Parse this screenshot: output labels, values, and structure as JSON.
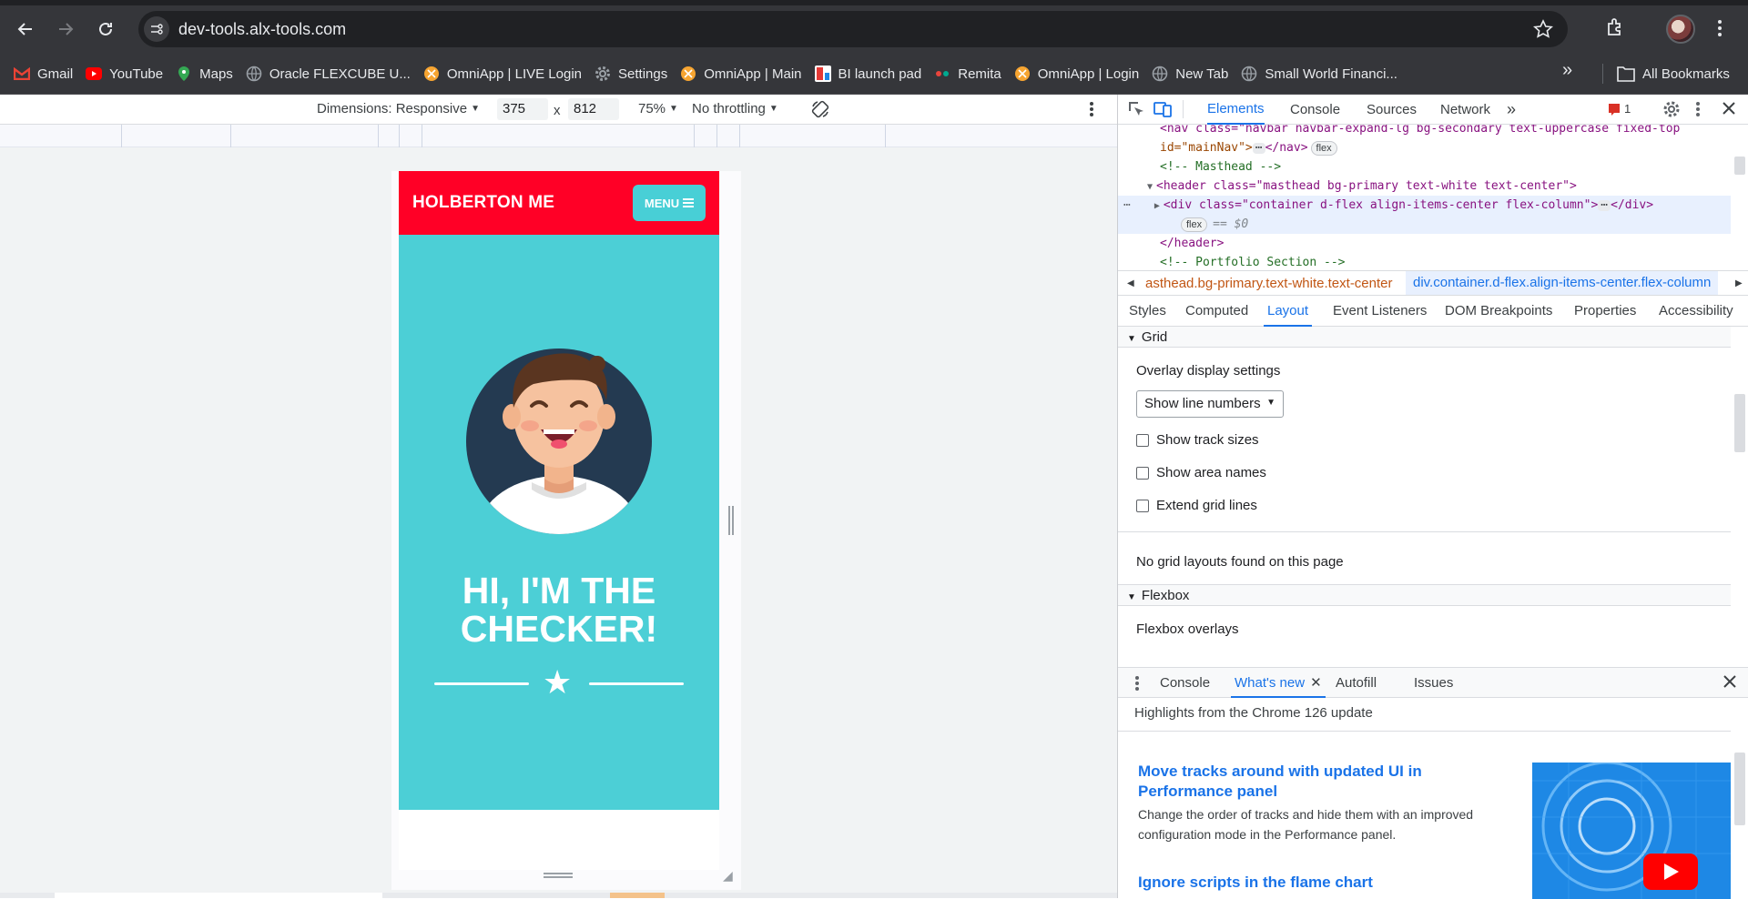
{
  "browser": {
    "url": "dev-tools.alx-tools.com",
    "bookmarks": [
      {
        "label": "Gmail",
        "icon": "gmail-icon",
        "color": "#ea4335"
      },
      {
        "label": "YouTube",
        "icon": "youtube-icon",
        "color": "#ff0000"
      },
      {
        "label": "Maps",
        "icon": "maps-icon",
        "color": "#34a853"
      },
      {
        "label": "Oracle FLEXCUBE U...",
        "icon": "globe-icon",
        "color": "#9aa0a6"
      },
      {
        "label": "OmniApp | LIVE Login",
        "icon": "omniapp-icon",
        "color": "#f7a531"
      },
      {
        "label": "Settings",
        "icon": "gear-icon",
        "color": "#9aa0a6"
      },
      {
        "label": "OmniApp | Main",
        "icon": "omniapp-icon",
        "color": "#f7a531"
      },
      {
        "label": "BI launch pad",
        "icon": "bi-icon",
        "color": "#e53935"
      },
      {
        "label": "Remita",
        "icon": "remita-icon",
        "color": "#e8453c"
      },
      {
        "label": "OmniApp | Login",
        "icon": "omniapp-icon",
        "color": "#f7a531"
      },
      {
        "label": "New Tab",
        "icon": "globe-icon",
        "color": "#9aa0a6"
      },
      {
        "label": "Small World Financi...",
        "icon": "globe-icon",
        "color": "#9aa0a6"
      }
    ],
    "all_bookmarks": "All Bookmarks"
  },
  "device_toolbar": {
    "dimensions": "Dimensions: Responsive",
    "width": "375",
    "times": "x",
    "height": "812",
    "zoom": "75%",
    "throttling": "No throttling"
  },
  "site": {
    "brand": "HOLBERTON ME",
    "menu": "MENU",
    "hero_line1": "HI, I'M THE",
    "hero_line2": "CHECKER!",
    "nav_color": "#ff0026",
    "masthead_color": "#4ccfd6"
  },
  "devtools": {
    "tabs": [
      "Elements",
      "Console",
      "Sources",
      "Network"
    ],
    "issues_count": "1",
    "dom": {
      "nav_line": "<nav class=\"navbar navbar-expand-lg bg-secondary text-uppercase fixed-top",
      "nav_id": "id=\"mainNav\">",
      "nav_close": "</nav>",
      "flex_badge": "flex",
      "comment_masthead": "<!-- Masthead -->",
      "header_open": "<header class=\"masthead bg-primary text-white text-center\">",
      "div_open": "<div class=\"container d-flex align-items-center flex-column\">",
      "div_close": "</div>",
      "eq_zero": "== $0",
      "header_close": "</header>",
      "comment_portfolio": "<!-- Portfolio Section -->"
    },
    "breadcrumb": {
      "crumb1": "asthead.bg-primary.text-white.text-center",
      "crumb2": "div.container.d-flex.align-items-center.flex-column"
    },
    "sub_tabs": [
      "Styles",
      "Computed",
      "Layout",
      "Event Listeners",
      "DOM Breakpoints",
      "Properties",
      "Accessibility"
    ],
    "layout": {
      "grid_section": "Grid",
      "overlay_settings": "Overlay display settings",
      "show_line_numbers": "Show line numbers",
      "show_track_sizes": "Show track sizes",
      "show_area_names": "Show area names",
      "extend_grid_lines": "Extend grid lines",
      "no_grid": "No grid layouts found on this page",
      "flexbox_section": "Flexbox",
      "flexbox_overlays": "Flexbox overlays"
    },
    "drawer": {
      "tabs": [
        "Console",
        "What's new",
        "Autofill",
        "Issues"
      ],
      "highlights": "Highlights from the Chrome 126 update",
      "article1_title": "Move tracks around with updated UI in Performance panel",
      "article1_desc": "Change the order of tracks and hide them with an improved configuration mode in the Performance panel.",
      "article2_title": "Ignore scripts in the flame chart"
    }
  }
}
